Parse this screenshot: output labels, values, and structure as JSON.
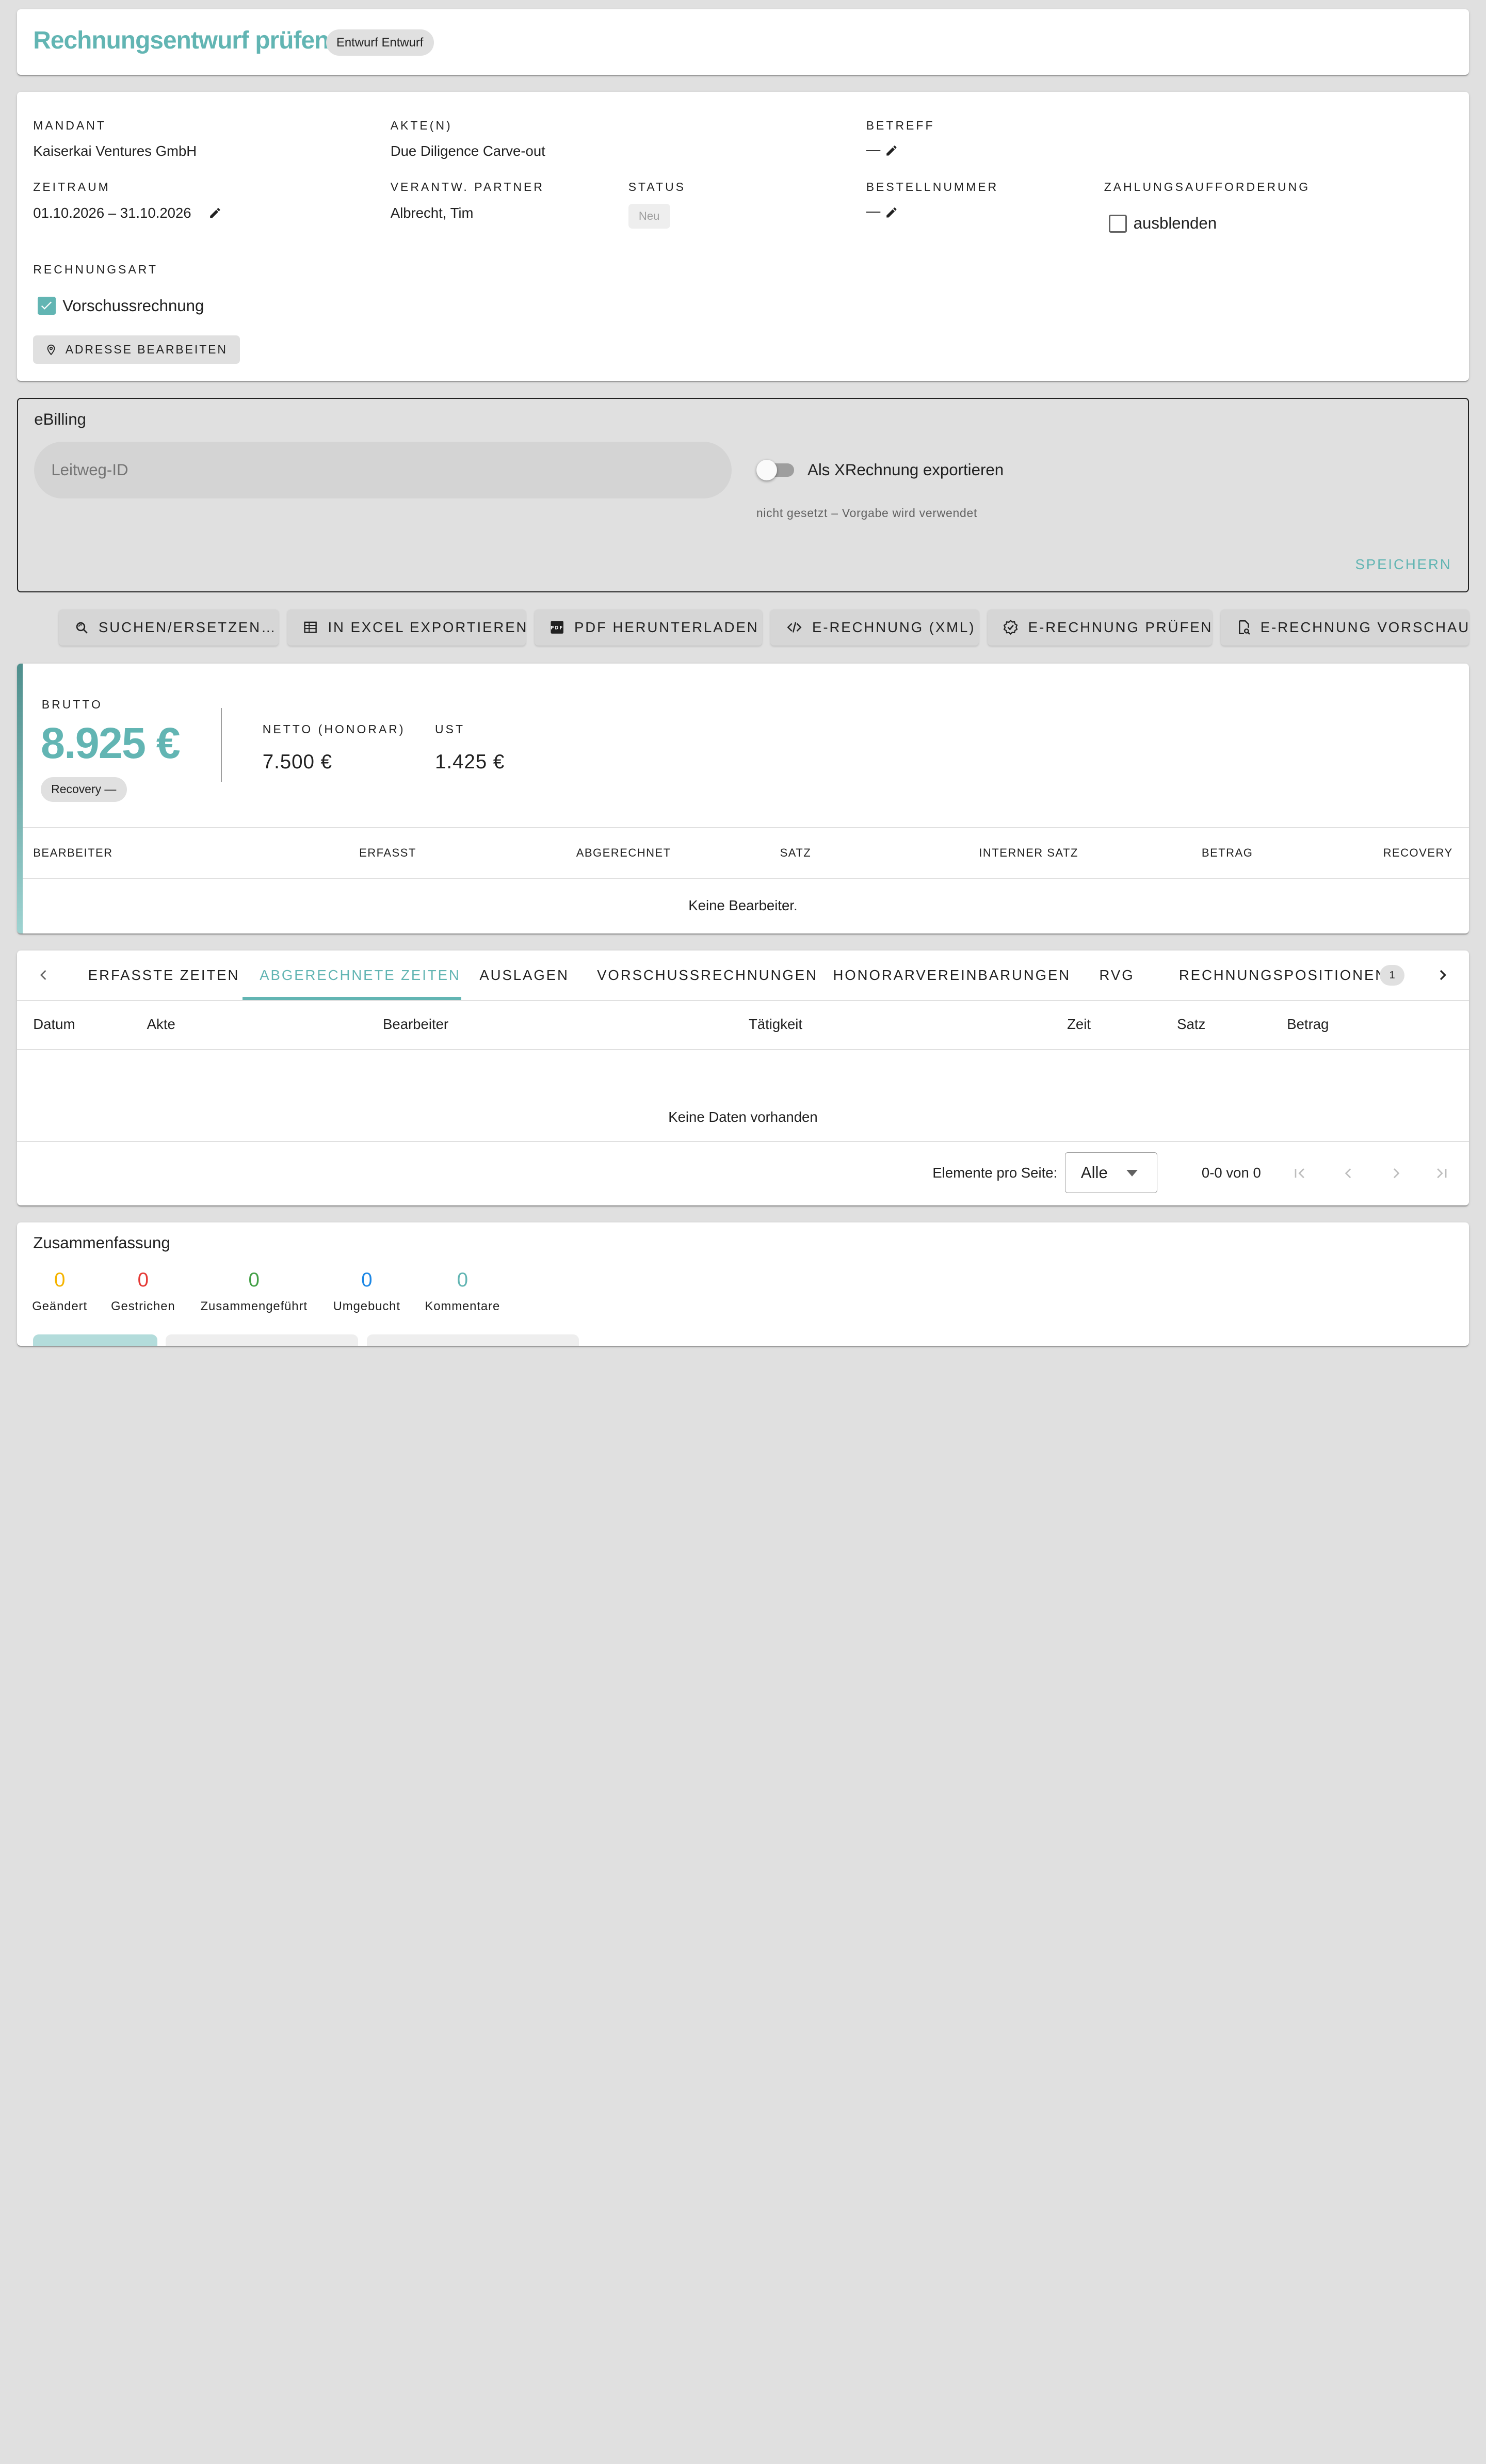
{
  "header": {
    "title": "Rechnungsentwurf prüfen",
    "badge": "Entwurf Entwurf"
  },
  "details": {
    "mandant_label": "MANDANT",
    "mandant_value": "Kaiserkai Ventures GmbH",
    "akte_label": "AKTE(N)",
    "akte_value": "Due Diligence Carve-out",
    "betreff_label": "BETREFF",
    "betreff_value": "—",
    "zeitraum_label": "ZEITRAUM",
    "zeitraum_value": "01.10.2026 – 31.10.2026",
    "partner_label": "VERANTW. PARTNER",
    "partner_value": "Albrecht, Tim",
    "status_label": "STATUS",
    "status_value": "Neu",
    "bestell_label": "BESTELLNUMMER",
    "bestell_value": "—",
    "zahlung_label": "ZAHLUNGSAUFFORDERUNG",
    "zahlung_checkbox_label": "ausblenden",
    "zahlung_checked": false,
    "rechnungsart_label": "RECHNUNGSART",
    "rechnungsart_checkbox_label": "Vorschussrechnung",
    "rechnungsart_checked": true,
    "address_button": "ADRESSE BEARBEITEN"
  },
  "ebilling": {
    "title": "eBilling",
    "leitweg_placeholder": "Leitweg-ID",
    "xrechnung_label": "Als XRechnung exportieren",
    "xrechnung_on": false,
    "hint": "nicht gesetzt – Vorgabe wird verwendet",
    "save": "SPEICHERN"
  },
  "toolbar": {
    "search_replace": "SUCHEN/ERSETZEN…",
    "excel": "IN EXCEL EXPORTIEREN",
    "pdf": "PDF HERUNTERLADEN",
    "xml": "E-RECHNUNG (XML)",
    "check": "E-RECHNUNG PRÜFEN",
    "preview": "E-RECHNUNG VORSCHAU"
  },
  "totals": {
    "brutto_label": "BRUTTO",
    "brutto_value": "8.925 €",
    "recovery_chip": "Recovery —",
    "netto_label": "NETTO (HONORAR)",
    "netto_value": "7.500 €",
    "ust_label": "UST",
    "ust_value": "1.425 €",
    "columns": [
      "BEARBEITER",
      "ERFASST",
      "ABGERECHNET",
      "SATZ",
      "INTERNER SATZ",
      "BETRAG",
      "RECOVERY"
    ],
    "empty": "Keine Bearbeiter."
  },
  "tabs": {
    "items": [
      "ERFASSTE ZEITEN",
      "ABGERECHNETE ZEITEN",
      "AUSLAGEN",
      "VORSCHUSSRECHNUNGEN",
      "HONORARVEREINBARUNGEN",
      "RVG",
      "RECHNUNGSPOSITIONEN"
    ],
    "active": "ABGERECHNETE ZEITEN",
    "positions_count": "1",
    "columns": [
      "Datum",
      "Akte",
      "Bearbeiter",
      "Tätigkeit",
      "Zeit",
      "Satz",
      "Betrag"
    ],
    "empty": "Keine Daten vorhanden",
    "per_page_label": "Elemente pro Seite:",
    "per_page_value": "Alle",
    "range": "0-0 von 0"
  },
  "summary": {
    "title": "Zusammenfassung",
    "stats": [
      {
        "value": "0",
        "label": "Geändert",
        "color": "#f5b400"
      },
      {
        "value": "0",
        "label": "Gestrichen",
        "color": "#e53935"
      },
      {
        "value": "0",
        "label": "Zusammengeführt",
        "color": "#43a047"
      },
      {
        "value": "0",
        "label": "Umgebucht",
        "color": "#1e88e5"
      },
      {
        "value": "0",
        "label": "Kommentare",
        "color": "#62b5b3"
      }
    ]
  }
}
